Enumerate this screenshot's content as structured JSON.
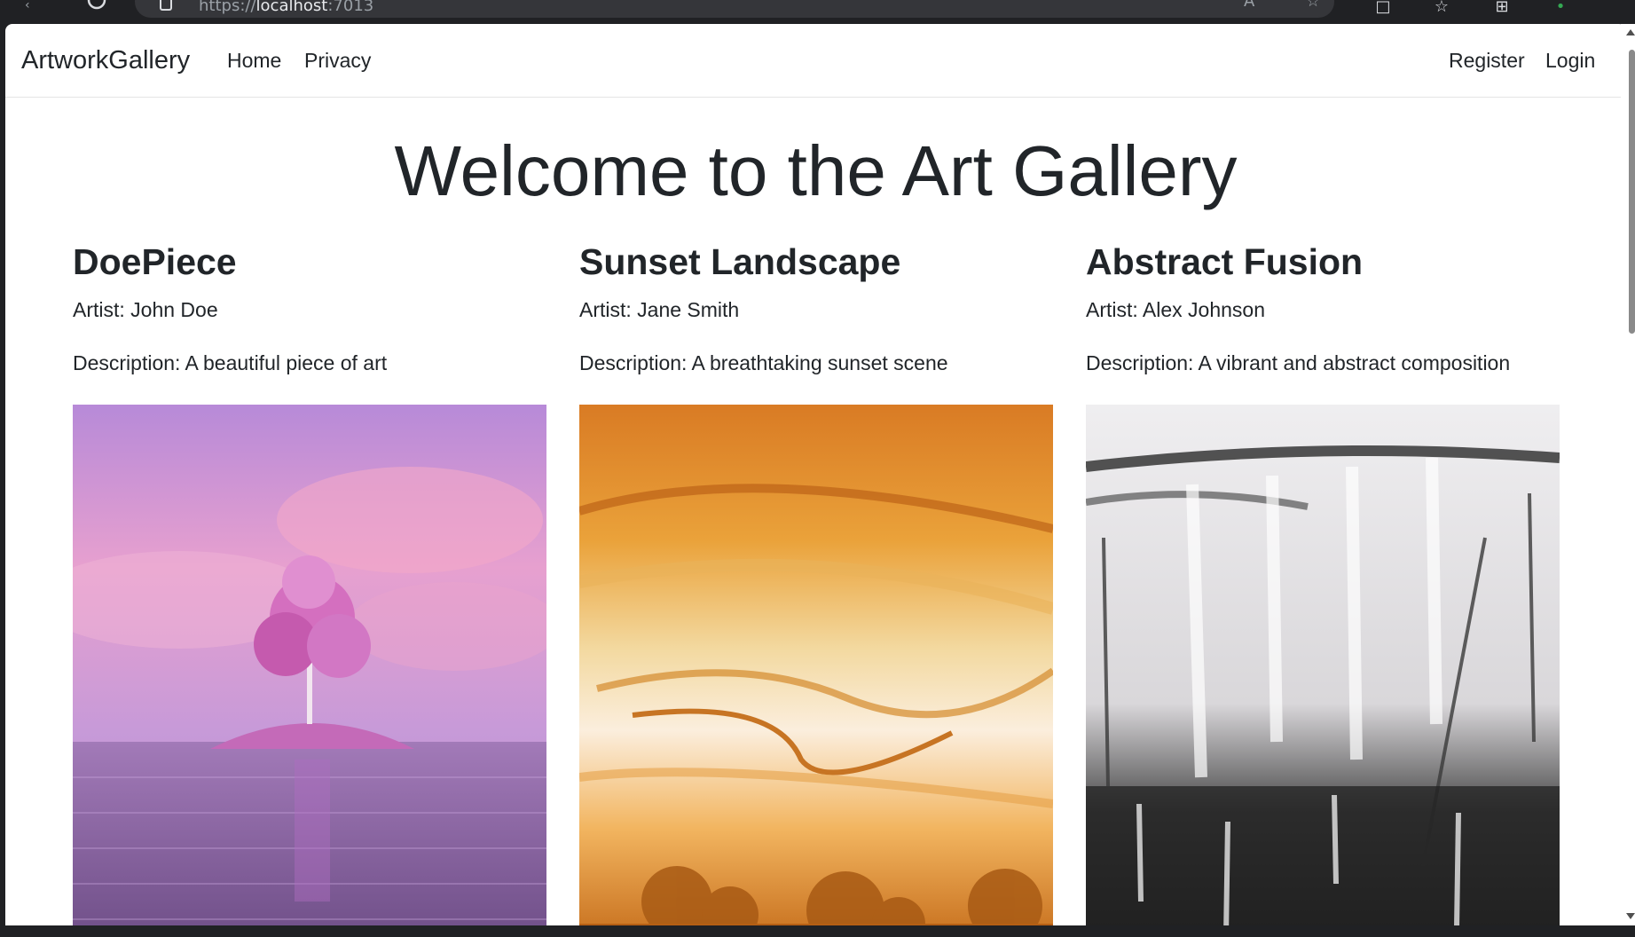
{
  "browser": {
    "address_scheme": "https://",
    "address_host": "localhost",
    "address_port": ":7013",
    "icons": [
      "back-icon",
      "refresh-icon",
      "lock-icon",
      "read-aloud-icon",
      "favorite-star-icon",
      "split-screen-icon",
      "favorites-icon",
      "collections-icon",
      "extensions-icon"
    ]
  },
  "navbar": {
    "brand": "ArtworkGallery",
    "links": [
      "Home",
      "Privacy"
    ],
    "register": "Register",
    "login": "Login"
  },
  "main": {
    "heading": "Welcome to the Art Gallery",
    "artworks": [
      {
        "title": "DoePiece",
        "artist": "Artist: John Doe",
        "description": "Description: A beautiful piece of art"
      },
      {
        "title": "Sunset Landscape",
        "artist": "Artist: Jane Smith",
        "description": "Description: A breathtaking sunset scene"
      },
      {
        "title": "Abstract Fusion",
        "artist": "Artist: Alex Johnson",
        "description": "Description: A vibrant and abstract composition"
      }
    ]
  },
  "colors": {
    "text": "#212529",
    "chrome_background": "#202124",
    "page_background": "#ffffff"
  }
}
